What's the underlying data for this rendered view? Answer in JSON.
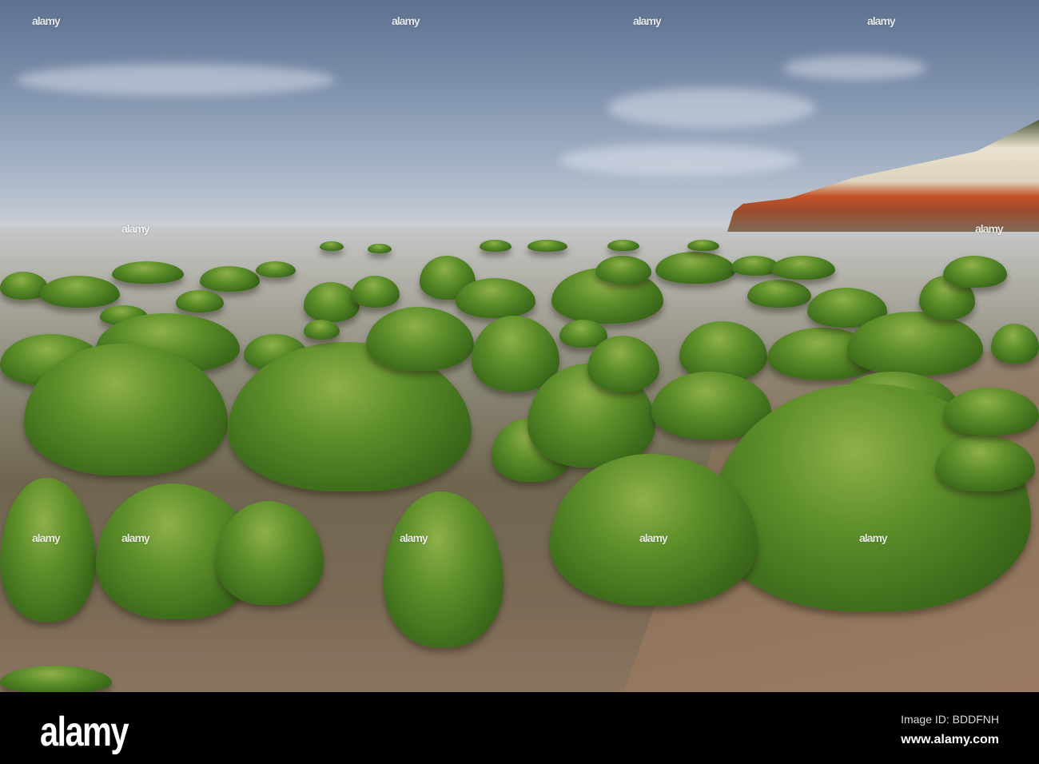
{
  "watermark": {
    "text": "alamy"
  },
  "footer": {
    "logo": "alamy",
    "image_id": "Image ID: BDDFNH",
    "url": "www.alamy.com"
  },
  "colors": {
    "moss": "#5e8f2a",
    "sky": "#7d8fab",
    "cliff_red": "#c4552a",
    "footer": "#000000"
  }
}
